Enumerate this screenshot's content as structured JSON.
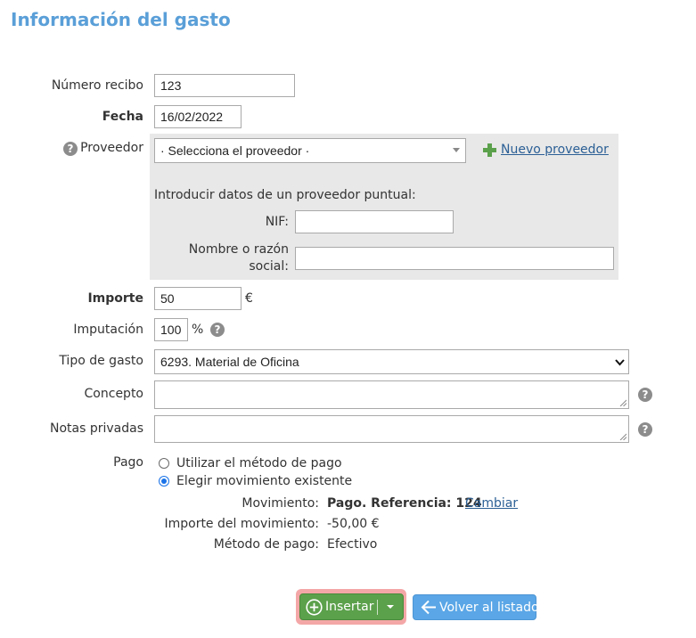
{
  "page": {
    "title": "Información del gasto"
  },
  "form": {
    "numero_recibo": {
      "label": "Número recibo",
      "value": "123"
    },
    "fecha": {
      "label": "Fecha",
      "value": "16/02/2022"
    },
    "proveedor": {
      "label": "Proveedor",
      "select_value": "· Selecciona el proveedor ·",
      "nuevo_link": "Nuevo proveedor",
      "puntual_heading": "Introducir datos de un proveedor puntual:",
      "nif_label": "NIF:",
      "nif_value": "",
      "nombre_label_1": "Nombre o razón",
      "nombre_label_2": "social:",
      "nombre_value": ""
    },
    "importe": {
      "label": "Importe",
      "value": "50",
      "unit": "€"
    },
    "imputacion": {
      "label": "Imputación",
      "value": "100",
      "unit": "%"
    },
    "tipo_gasto": {
      "label": "Tipo de gasto",
      "value": "6293. Material de Oficina"
    },
    "concepto": {
      "label": "Concepto",
      "value": ""
    },
    "notas_privadas": {
      "label": "Notas privadas",
      "value": ""
    },
    "pago": {
      "label": "Pago",
      "options": [
        {
          "label": "Utilizar el método de pago",
          "selected": false
        },
        {
          "label": "Elegir movimiento existente",
          "selected": true
        }
      ],
      "movimiento_label": "Movimiento:",
      "movimiento_value": "Pago. Referencia: 124",
      "cambiar_link": "Cambiar",
      "importe_mov_label": "Importe del movimiento:",
      "importe_mov_value": "-50,00 €",
      "metodo_label": "Método de pago:",
      "metodo_value": "Efectivo"
    }
  },
  "actions": {
    "insertar_label": "Insertar",
    "volver_label": "Volver al listado"
  },
  "icons": {
    "help": "question-circle-icon",
    "plus": "plus-icon",
    "add": "plus-circle-icon",
    "back": "arrow-left-icon",
    "caret": "caret-down-icon"
  },
  "colors": {
    "title": "#5a9fd8",
    "panel": "#e8e8e8",
    "insert_button": "#5ba04b",
    "back_button": "#5aa6e6",
    "highlight": "#f4a7a7",
    "link": "#2b5f95",
    "plus_icon": "#5ba04b"
  }
}
